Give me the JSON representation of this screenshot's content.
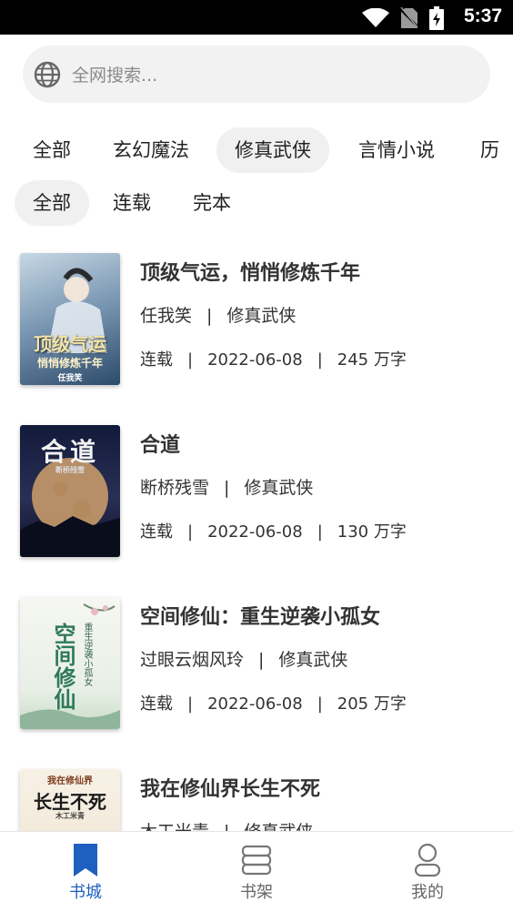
{
  "status_bar": {
    "time": "5:37"
  },
  "search": {
    "placeholder": "全网搜索..."
  },
  "categories": [
    {
      "label": "全部",
      "active": false
    },
    {
      "label": "玄幻魔法",
      "active": false
    },
    {
      "label": "修真武侠",
      "active": true
    },
    {
      "label": "言情小说",
      "active": false
    },
    {
      "label": "历",
      "active": false
    }
  ],
  "status_filters": [
    {
      "label": "全部",
      "active": true
    },
    {
      "label": "连载",
      "active": false
    },
    {
      "label": "完本",
      "active": false
    }
  ],
  "books": [
    {
      "title": "顶级气运，悄悄修炼千年",
      "author": "任我笑",
      "category": "修真武侠",
      "status": "连载",
      "date": "2022-06-08",
      "words": "245 万字",
      "cover_text": "顶级气运",
      "cover_sub": "悄悄修炼千年",
      "cover_author": "任我笑"
    },
    {
      "title": "合道",
      "author": "断桥残雪",
      "category": "修真武侠",
      "status": "连载",
      "date": "2022-06-08",
      "words": "130 万字",
      "cover_text": "合道",
      "cover_sub": "断桥残雪",
      "cover_author": ""
    },
    {
      "title": "空间修仙：重生逆袭小孤女",
      "author": "过眼云烟风玲",
      "category": "修真武侠",
      "status": "连载",
      "date": "2022-06-08",
      "words": "205 万字",
      "cover_text": "空间修仙",
      "cover_sub": "重生逆袭小孤女",
      "cover_author": ""
    },
    {
      "title": "我在修仙界长生不死",
      "author": "木工米青",
      "category": "修真武侠",
      "status": "",
      "date": "",
      "words": "",
      "cover_text": "长生不死",
      "cover_sub": "我在修仙界",
      "cover_author": "木工米青"
    }
  ],
  "nav": [
    {
      "label": "书城",
      "icon": "bookmark-icon",
      "active": true
    },
    {
      "label": "书架",
      "icon": "bookshelf-icon",
      "active": false
    },
    {
      "label": "我的",
      "icon": "user-icon",
      "active": false
    }
  ],
  "colors": {
    "accent": "#1e5fbf",
    "chip_bg": "#f0f0f0",
    "search_bg": "#f2f2f2"
  }
}
